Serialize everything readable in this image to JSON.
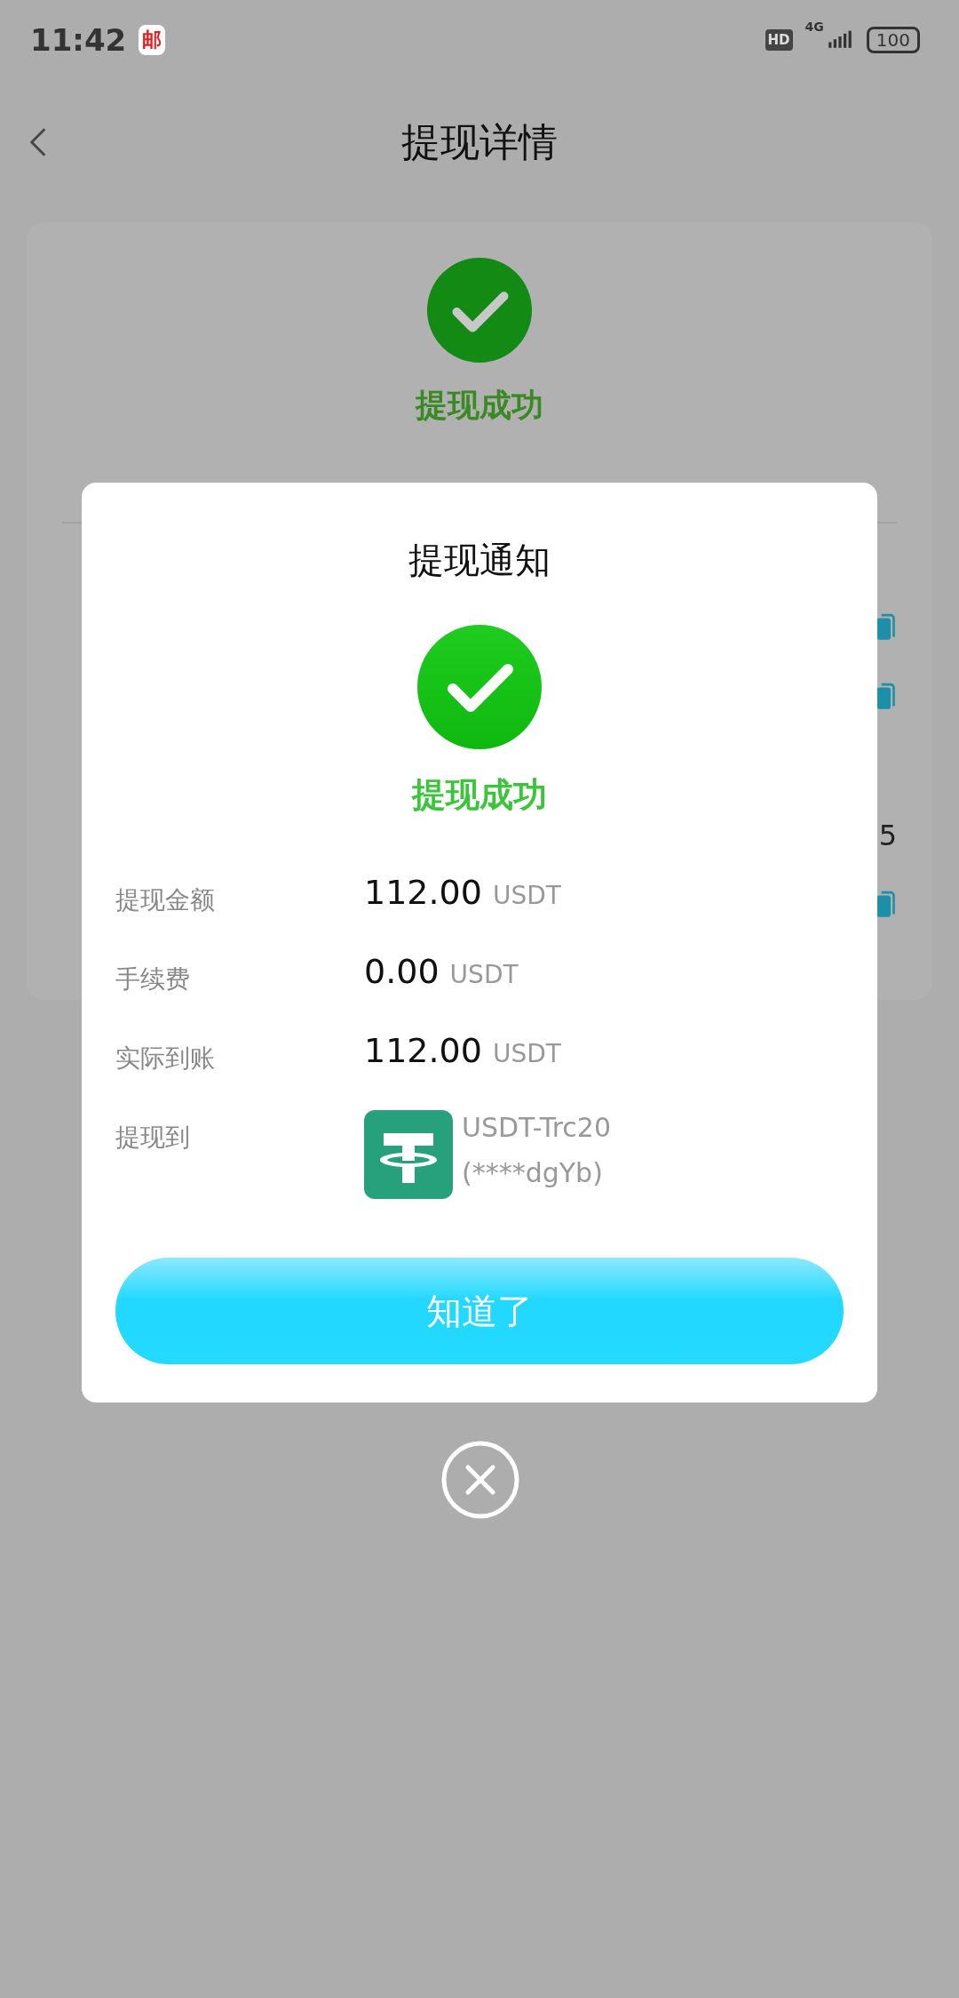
{
  "status_bar": {
    "time": "11:42",
    "app_badge": "邮",
    "hd": "HD",
    "network": "4G",
    "battery": "100"
  },
  "header": {
    "title": "提现详情"
  },
  "summary": {
    "status": "提现成功",
    "rows": [
      {
        "kind": "hidden"
      },
      {
        "kind": "copy"
      },
      {
        "kind": "copy"
      },
      {
        "kind": "hidden"
      },
      {
        "kind": "text",
        "value": "5"
      },
      {
        "kind": "copy"
      }
    ]
  },
  "dialog": {
    "title": "提现通知",
    "status": "提现成功",
    "rows": [
      {
        "kind": "amount",
        "label": "提现金额",
        "amount": "112.00",
        "unit": "USDT"
      },
      {
        "kind": "amount",
        "label": "手续费",
        "amount": "0.00",
        "unit": "USDT"
      },
      {
        "kind": "amount",
        "label": "实际到账",
        "amount": "112.00",
        "unit": "USDT"
      },
      {
        "kind": "account",
        "label": "提现到",
        "name": "USDT-Trc20",
        "account": "(****dgYb)"
      }
    ],
    "button": "知道了"
  }
}
